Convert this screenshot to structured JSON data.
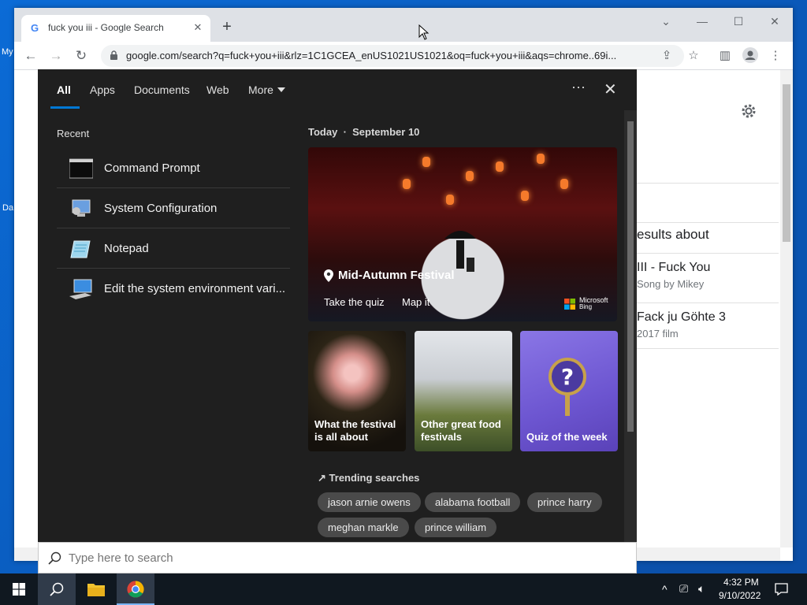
{
  "desktop": {
    "label_1": "My",
    "label_2": "Da"
  },
  "browser": {
    "tab_title": "fuck you iii - Google Search",
    "url": "google.com/search?q=fuck+you+iii&rlz=1C1GCEA_enUS1021US1021&oq=fuck+you+iii&aqs=chrome..69i...",
    "results_heading": "esults about",
    "results": [
      {
        "title": "III - Fuck You",
        "subtitle": "Song by Mikey"
      },
      {
        "title": "Fack ju Göhte 3",
        "subtitle": "2017 film"
      }
    ]
  },
  "search_panel": {
    "tabs": [
      "All",
      "Apps",
      "Documents",
      "Web",
      "More"
    ],
    "recent_title": "Recent",
    "recent_items": [
      {
        "label": "Command Prompt",
        "icon": "command-prompt-icon"
      },
      {
        "label": "System Configuration",
        "icon": "system-configuration-icon"
      },
      {
        "label": "Notepad",
        "icon": "notepad-icon"
      },
      {
        "label": "Edit the system environment vari...",
        "icon": "system-properties-icon"
      }
    ],
    "today": "Today",
    "date": "September 10",
    "hero": {
      "title": "Mid-Autumn Festival",
      "link_1": "Take the quiz",
      "link_2": "Map it",
      "brand": "Microsoft",
      "brand_sub": "Bing"
    },
    "tiles": [
      {
        "label": "What the festival is all about"
      },
      {
        "label": "Other great food festivals"
      },
      {
        "label": "Quiz of the week"
      }
    ],
    "trending_title": "Trending searches",
    "trending": [
      "jason arnie owens",
      "alabama football",
      "prince harry",
      "meghan markle",
      "prince william"
    ]
  },
  "searchbox": {
    "placeholder": "Type here to search"
  },
  "taskbar": {
    "time": "4:32 PM",
    "date": "9/10/2022"
  },
  "colors": {
    "accent": "#0078d4",
    "panel_bg": "#1f1f1f",
    "taskbar_bg": "#101820"
  }
}
